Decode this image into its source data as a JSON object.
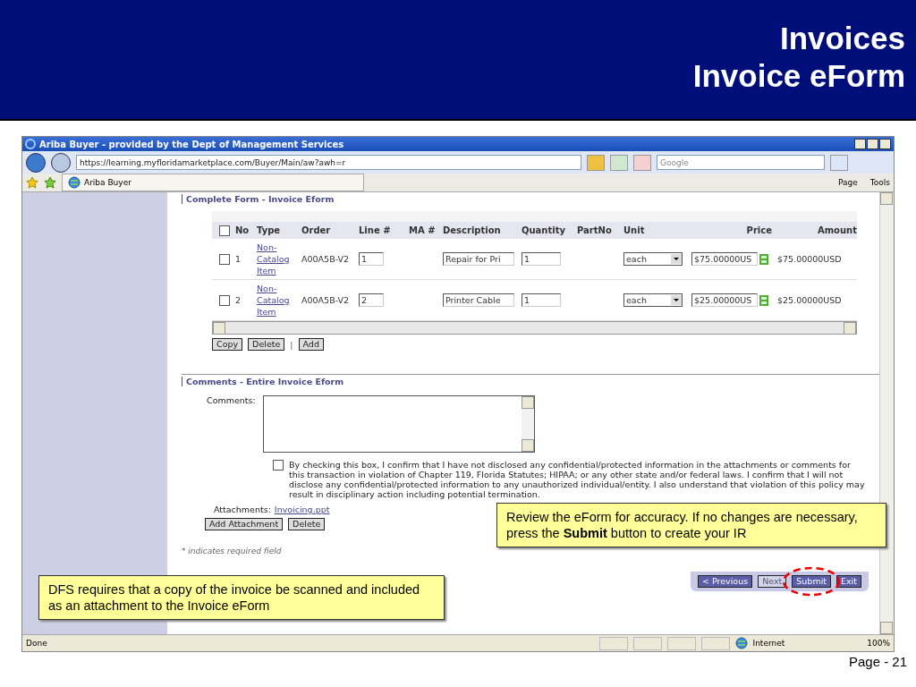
{
  "slide": {
    "title_lines": [
      "Invoices",
      "Invoice eForm"
    ],
    "page": "Page - 21"
  },
  "browser": {
    "title": "Ariba Buyer - provided by the Dept of Management Services",
    "address": "https://learning.myfloridamarketplace.com/Buyer/Main/aw?awh=r",
    "search_placeholder": "Google",
    "tab": "Ariba Buyer",
    "commands": [
      "Page",
      "Tools"
    ],
    "status": "Done",
    "zone": "Internet",
    "zoom": "100%"
  },
  "lines": {
    "section_title": "Complete Form - Invoice Eform",
    "select_all_checked": false,
    "columns": [
      "No",
      "Type",
      "Order",
      "Line #",
      "MA #",
      "Description",
      "Quantity",
      "PartNo",
      "Unit",
      "Price",
      "Amount"
    ],
    "rows": [
      {
        "checked": false,
        "no": "1",
        "type": "Non-Catalog Item",
        "order": "A00A5B-V2",
        "line": "1",
        "description": "Repair for Pri",
        "quantity": "1",
        "unit": "each",
        "price": "$75.00000US",
        "amount": "$75.00000USD"
      },
      {
        "checked": false,
        "no": "2",
        "type": "Non-Catalog Item",
        "order": "A00A5B-V2",
        "line": "2",
        "description": "Printer Cable",
        "quantity": "1",
        "unit": "each",
        "price": "$25.00000US",
        "amount": "$25.00000USD"
      }
    ],
    "actions": [
      "Copy",
      "Delete"
    ],
    "separator": "|",
    "add": "Add"
  },
  "comments": {
    "section_title": "Comments - Entire Invoice Eform",
    "label": "Comments:",
    "confirm_checked": false,
    "confirm_text": "By checking this box, I confirm that I have not disclosed any confidential/protected information in the attachments or comments for this transaction in violation of Chapter 119, Florida Statutes; HIPAA; or any other state and/or federal laws. I confirm that I will not disclose any confidential/protected information to any unauthorized individual/entity. I also understand that violation of this policy may result in disciplinary action including potential termination.",
    "attachments_label": "Attachments:",
    "attachment": "Invoicing.ppt",
    "buttons": [
      "Add Attachment",
      "Delete"
    ],
    "required_note": "* indicates required field"
  },
  "nav_buttons": [
    {
      "label": "< Previous",
      "disabled": false
    },
    {
      "label": "Next",
      "disabled": true
    },
    {
      "label": "Submit",
      "disabled": false
    },
    {
      "label": "Exit",
      "disabled": false
    }
  ],
  "callouts": [
    "Review the eForm for accuracy.  If no changes are necessary, press the **Submit** button to create your IR",
    "DFS requires that a copy of the invoice be scanned and included as an attachment to the Invoice eForm"
  ]
}
